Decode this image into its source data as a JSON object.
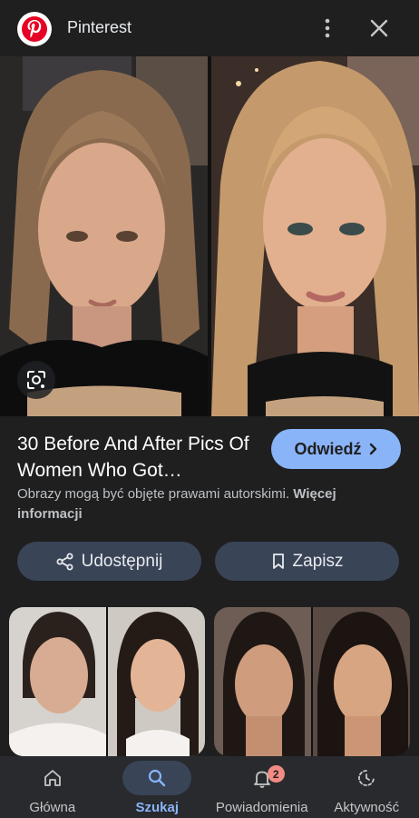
{
  "header": {
    "site_name": "Pinterest",
    "logo_icon": "pinterest-logo",
    "menu_icon": "more-vert-icon",
    "close_icon": "close-icon"
  },
  "hero": {
    "lens_icon": "google-lens-icon"
  },
  "result": {
    "title": "30 Before And After Pics Of Women Who Got…",
    "visit_label": "Odwiedź",
    "copyright_text": "Obrazy mogą być objęte prawami autorskimi.",
    "copyright_more": "Więcej informacji"
  },
  "actions": {
    "share_label": "Udostępnij",
    "save_label": "Zapisz"
  },
  "bottom_nav": {
    "items": [
      {
        "label": "Główna",
        "icon": "home-icon"
      },
      {
        "label": "Szukaj",
        "icon": "search-icon",
        "active": true
      },
      {
        "label": "Powiadomienia",
        "icon": "bell-icon",
        "badge": "2"
      },
      {
        "label": "Aktywność",
        "icon": "activity-icon"
      }
    ]
  },
  "colors": {
    "background": "#1f1f1f",
    "accent": "#8ab4f8",
    "button_bg": "#394457",
    "nav_bg": "#282a2e",
    "badge": "#f28b82",
    "brand": "#e60023"
  }
}
